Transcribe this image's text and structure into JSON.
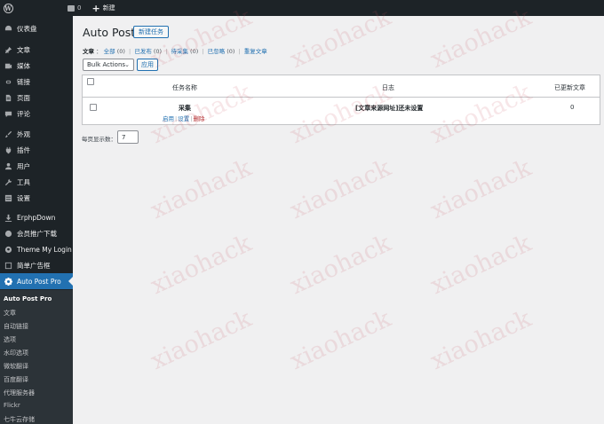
{
  "adminbar": {
    "logo_icon": "wordpress-logo-icon",
    "comments_count": "0",
    "new_label": "新建"
  },
  "sidebar": {
    "items": [
      {
        "label": "仪表盘",
        "icon": "dashboard-icon"
      },
      {
        "label": "文章",
        "icon": "pin-icon"
      },
      {
        "label": "媒体",
        "icon": "media-icon"
      },
      {
        "label": "链接",
        "icon": "link-icon"
      },
      {
        "label": "页面",
        "icon": "page-icon"
      },
      {
        "label": "评论",
        "icon": "comment-icon"
      },
      {
        "label": "外观",
        "icon": "brush-icon"
      },
      {
        "label": "插件",
        "icon": "plugin-icon"
      },
      {
        "label": "用户",
        "icon": "user-icon"
      },
      {
        "label": "工具",
        "icon": "wrench-icon"
      },
      {
        "label": "设置",
        "icon": "settings-icon"
      },
      {
        "label": "ErphpDown",
        "icon": "download-icon"
      },
      {
        "label": "会员推广下载",
        "icon": "globe-icon"
      },
      {
        "label": "Theme My Login",
        "icon": "login-icon"
      },
      {
        "label": "简单广告框",
        "icon": "ad-box-icon"
      },
      {
        "label": "Auto Post Pro",
        "icon": "gear-icon"
      }
    ],
    "submenu": [
      "Auto Post Pro",
      "文章",
      "自动链接",
      "选项",
      "水印选项",
      "微软翻译",
      "百度翻译",
      "代理服务器",
      "Flickr",
      "七牛云存储"
    ]
  },
  "main": {
    "title": "Auto Post",
    "add_new": "新建任务",
    "filters": {
      "label": "文章",
      "links": [
        {
          "text": "全部",
          "count": "(0)"
        },
        {
          "text": "已发布",
          "count": "(0)"
        },
        {
          "text": "待采集",
          "count": "(0)"
        },
        {
          "text": "已忽略",
          "count": "(0)"
        },
        {
          "text": "重复文章",
          "count": ""
        }
      ]
    },
    "bulk_actions": "Bulk Actions",
    "apply": "应用",
    "table": {
      "columns": [
        "任务名称",
        "日志",
        "已更新文章"
      ],
      "rows": [
        {
          "name": "采集",
          "log": "[文章来源网址]还未设置",
          "updated": "0",
          "actions": [
            "启用",
            "设置",
            "删除"
          ]
        }
      ]
    },
    "per_page_label": "每页显示数：",
    "per_page_value": "7"
  },
  "watermark": "xiaohack"
}
